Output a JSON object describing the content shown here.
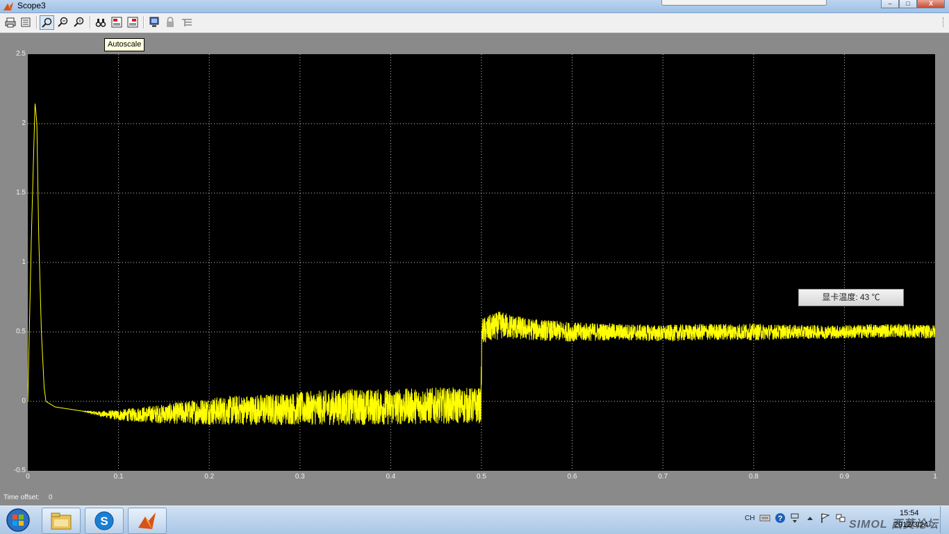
{
  "window": {
    "title": "Scope3",
    "controls": {
      "minimize": "–",
      "maximize": "□",
      "close": "X"
    }
  },
  "toolbar": {
    "buttons": [
      {
        "name": "print-icon",
        "active": false
      },
      {
        "name": "parameters-icon",
        "active": false
      },
      {
        "name": "zoom-icon",
        "active": true
      },
      {
        "name": "zoom-x-icon",
        "active": false
      },
      {
        "name": "zoom-y-icon",
        "active": false
      },
      {
        "name": "autoscale-icon",
        "active": false
      },
      {
        "name": "save-axes-icon",
        "active": false
      },
      {
        "name": "restore-axes-icon",
        "active": false
      },
      {
        "name": "float-scope-icon",
        "active": false
      },
      {
        "name": "lock-axes-icon",
        "active": false
      },
      {
        "name": "signal-selector-icon",
        "active": false
      }
    ],
    "tooltip": "Autoscale"
  },
  "chart_data": {
    "type": "line",
    "title": "",
    "xlabel": "",
    "ylabel": "",
    "xlim": [
      0,
      1
    ],
    "ylim": [
      -0.5,
      2.5
    ],
    "xticks": [
      "0",
      "0.1",
      "0.2",
      "0.3",
      "0.4",
      "0.5",
      "0.6",
      "0.7",
      "0.8",
      "0.9",
      "1"
    ],
    "yticks": [
      "2.5",
      "2",
      "1.5",
      "1",
      "0.5",
      "0",
      "-0.5"
    ],
    "grid": true,
    "series": [
      {
        "color": "#ffff00",
        "x": [
          0,
          0.004,
          0.008,
          0.01,
          0.012,
          0.015,
          0.018,
          0.02,
          0.025,
          0.03,
          0.04,
          0.06,
          0.08,
          0.1,
          0.15,
          0.2,
          0.25,
          0.3,
          0.35,
          0.4,
          0.45,
          0.4995,
          0.5005,
          0.52,
          0.55,
          0.6,
          0.65,
          0.7,
          0.75,
          0.8,
          0.85,
          0.9,
          0.95,
          1.0
        ],
        "y": [
          0,
          1.2,
          2.15,
          2.0,
          1.2,
          0.5,
          0.1,
          0.0,
          -0.02,
          -0.04,
          -0.05,
          -0.07,
          -0.09,
          -0.1,
          -0.09,
          -0.07,
          -0.06,
          -0.05,
          -0.04,
          -0.04,
          -0.03,
          -0.03,
          0.5,
          0.55,
          0.52,
          0.5,
          0.5,
          0.49,
          0.5,
          0.5,
          0.5,
          0.5,
          0.51,
          0.5
        ],
        "noise_band": [
          0,
          0,
          0,
          0,
          0,
          0,
          0,
          0,
          0,
          0,
          0,
          0,
          0.02,
          0.04,
          0.07,
          0.1,
          0.11,
          0.12,
          0.13,
          0.13,
          0.13,
          0.13,
          0.1,
          0.1,
          0.08,
          0.07,
          0.06,
          0.06,
          0.06,
          0.06,
          0.05,
          0.05,
          0.05,
          0.05
        ]
      }
    ]
  },
  "status": {
    "time_offset_label": "Time offset:",
    "time_offset_value": "0"
  },
  "overlay": {
    "gpu_temp": "显卡温度: 43 ℃"
  },
  "taskbar": {
    "apps": [
      {
        "name": "file-explorer-icon"
      },
      {
        "name": "sogou-icon"
      },
      {
        "name": "matlab-icon"
      }
    ],
    "tray": {
      "language": "CH",
      "time": "15:54",
      "date": "2012/3/24",
      "watermark": "SIMOL 西莫论坛"
    }
  }
}
